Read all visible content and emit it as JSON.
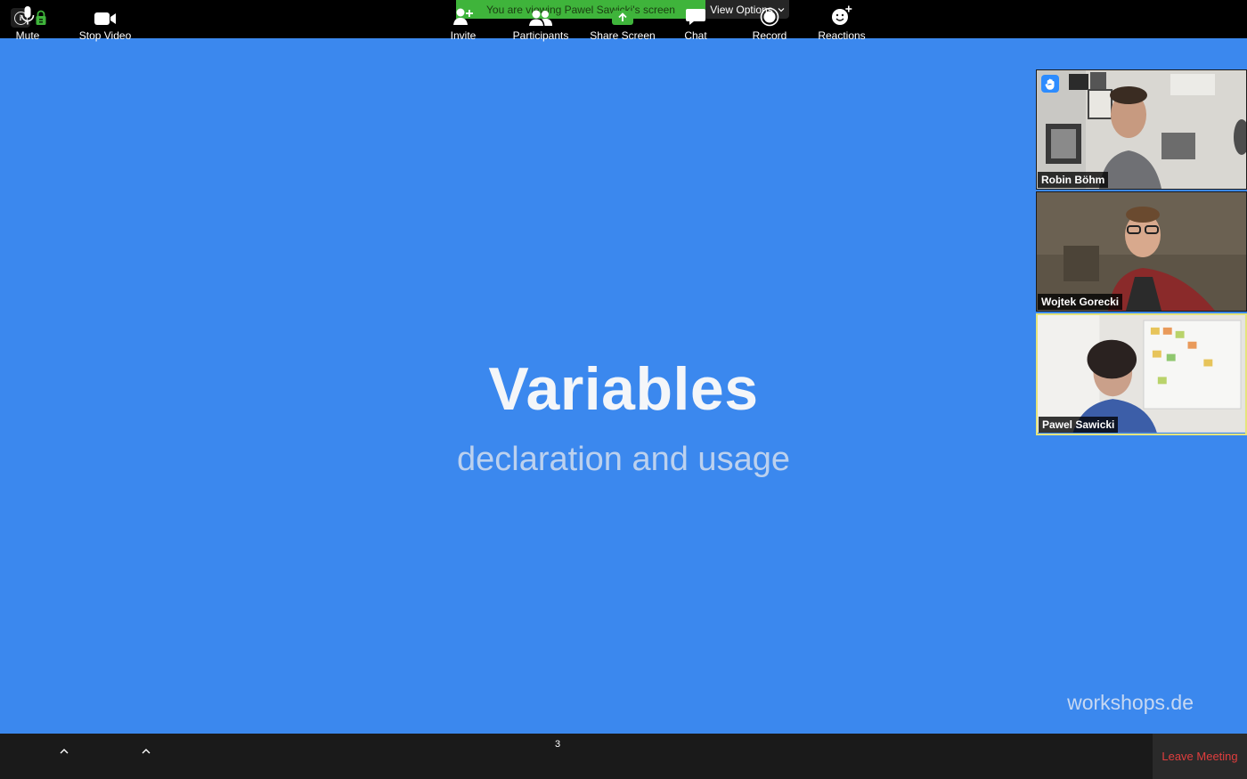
{
  "top_bar": {
    "banner_text": "You are viewing Pawel Sawicki's screen",
    "view_options_label": "View Options",
    "info_icon_glyph": "i"
  },
  "slide": {
    "title": "Variables",
    "subtitle": "declaration and usage",
    "brand": "workshops.de",
    "background_color": "#3b88ee"
  },
  "participants": [
    {
      "name": "Robin Böhm",
      "hand_raised": true
    },
    {
      "name": "Wojtek Gorecki",
      "hand_raised": false
    },
    {
      "name": "Pawel Sawicki",
      "hand_raised": false,
      "active_speaker": true
    }
  ],
  "toolbar": {
    "mute_label": "Mute",
    "stop_video_label": "Stop Video",
    "invite_label": "Invite",
    "participants_label": "Participants",
    "participants_count": "3",
    "share_screen_label": "Share Screen",
    "chat_label": "Chat",
    "record_label": "Record",
    "reactions_label": "Reactions",
    "leave_label": "Leave Meeting"
  },
  "colors": {
    "share_banner": "#3fb43b",
    "leave_text": "#e03e3e",
    "active_speaker_border": "#e6e47c",
    "raise_hand_badge": "#2d8cff"
  }
}
